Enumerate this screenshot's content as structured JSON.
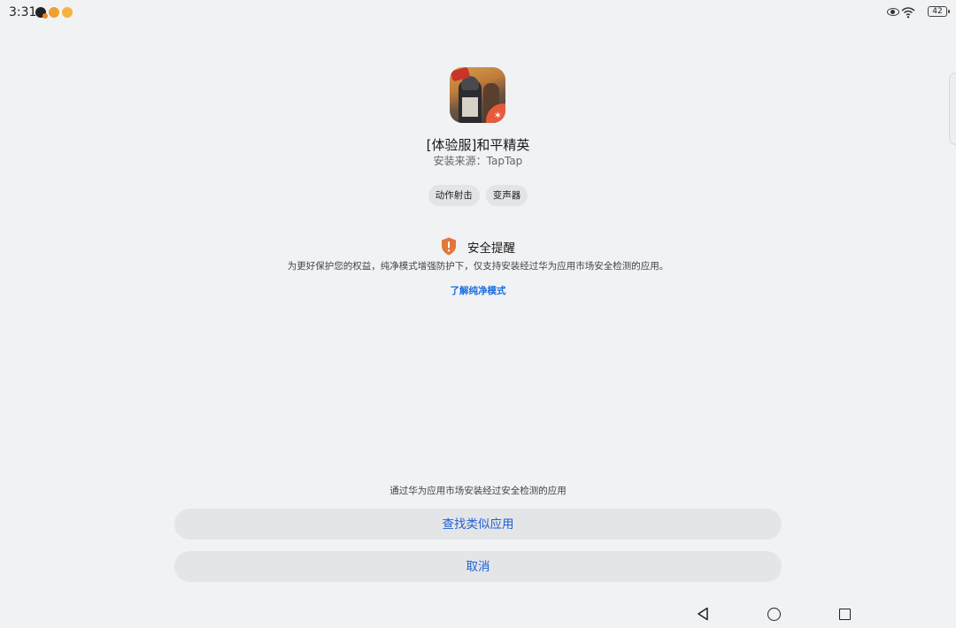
{
  "status_bar": {
    "time": "3:31",
    "notifications": [
      "app-notification-icon",
      "app-notification-icon",
      "app-notification-icon"
    ],
    "battery": "42"
  },
  "app": {
    "name": "[体验服]和平精英",
    "source": "安装来源：TapTap",
    "tags": [
      "动作射击",
      "变声器"
    ]
  },
  "security": {
    "title": "安全提醒",
    "description": "为更好保护您的权益，纯净模式增强防护下，仅支持安装经过华为应用市场安全检测的应用。",
    "learn_more": "了解纯净模式",
    "accent": "#e0783a"
  },
  "actions": {
    "note": "通过华为应用市场安装经过安全检测的应用",
    "find_similar": "查找类似应用",
    "cancel": "取消",
    "link_color": "#1f5fd4"
  }
}
